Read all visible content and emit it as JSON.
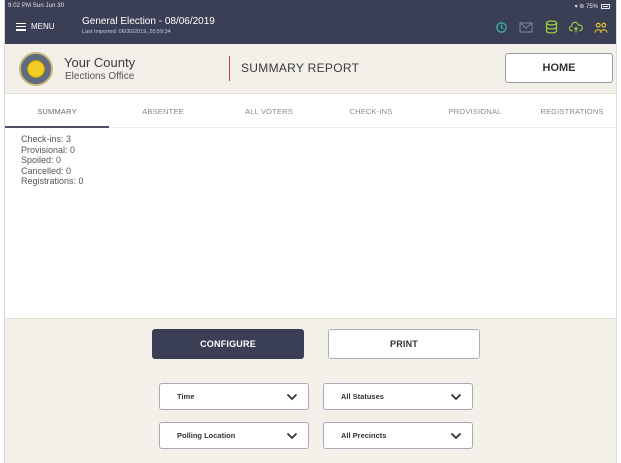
{
  "status": {
    "time_date": "9:02 PM  Sun Jun 30",
    "indicators": "▾ ⊛ 75%"
  },
  "titlebar": {
    "menu_label": "MENU",
    "election_title": "General Election - 08/06/2019",
    "last_imported": "Last Imported: 06/30/2019, 20:59:34",
    "icons": [
      "history-icon",
      "mail-icon",
      "database-icon",
      "cloud-upload-icon",
      "users-icon"
    ]
  },
  "header": {
    "county_name": "Your County",
    "county_office": "Elections Office",
    "report_title": "SUMMARY REPORT",
    "home_label": "HOME"
  },
  "tabs": [
    {
      "label": "SUMMARY",
      "active": true
    },
    {
      "label": "ABSENTEE",
      "active": false
    },
    {
      "label": "ALL VOTERS",
      "active": false
    },
    {
      "label": "CHECK-INS",
      "active": false
    },
    {
      "label": "PROVISIONAL",
      "active": false
    },
    {
      "label": "REGISTRATIONS",
      "active": false
    }
  ],
  "summary": {
    "checkins": "Check-ins: 3",
    "provisional": "Provisional: 0",
    "spoiled": "Spoiled: 0",
    "cancelled": "Cancelled: 0",
    "registrations": "Registrations: 0"
  },
  "actions": {
    "configure_label": "CONFIGURE",
    "print_label": "PRINT"
  },
  "filters": {
    "time": "Time",
    "statuses": "All Statuses",
    "polling_location": "Polling Location",
    "precincts": "All Precincts"
  },
  "colors": {
    "nav_dark": "#3b3f55",
    "header_beige": "#f3f0ea",
    "accent_divider": "#c0385a",
    "icon_green": "#9bd23c",
    "icon_teal": "#3fb6a6"
  }
}
